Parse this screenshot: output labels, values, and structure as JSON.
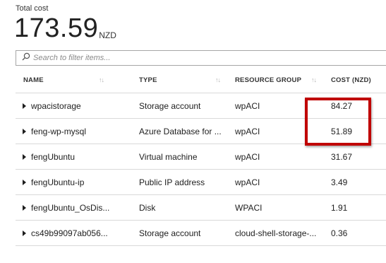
{
  "summary": {
    "label": "Total cost",
    "value": "173.59",
    "currency": "NZD"
  },
  "filter": {
    "placeholder": "Search to filter items..."
  },
  "table": {
    "columns": {
      "name": "NAME",
      "type": "TYPE",
      "resource_group": "RESOURCE GROUP",
      "cost": "COST (NZD)"
    },
    "rows": [
      {
        "name": "wpacistorage",
        "type": "Storage account",
        "resource_group": "wpACI",
        "cost": "84.27"
      },
      {
        "name": "feng-wp-mysql",
        "type": "Azure Database for ...",
        "resource_group": "wpACI",
        "cost": "51.89"
      },
      {
        "name": "fengUbuntu",
        "type": "Virtual machine",
        "resource_group": "wpACI",
        "cost": "31.67"
      },
      {
        "name": "fengUbuntu-ip",
        "type": "Public IP address",
        "resource_group": "wpACI",
        "cost": "3.49"
      },
      {
        "name": "fengUbuntu_OsDis...",
        "type": "Disk",
        "resource_group": "WPACI",
        "cost": "1.91"
      },
      {
        "name": "cs49b99097ab056...",
        "type": "Storage account",
        "resource_group": "cloud-shell-storage-...",
        "cost": "0.36"
      }
    ]
  },
  "colors": {
    "highlight": "#c00000",
    "divider": "#d9d9d9"
  }
}
